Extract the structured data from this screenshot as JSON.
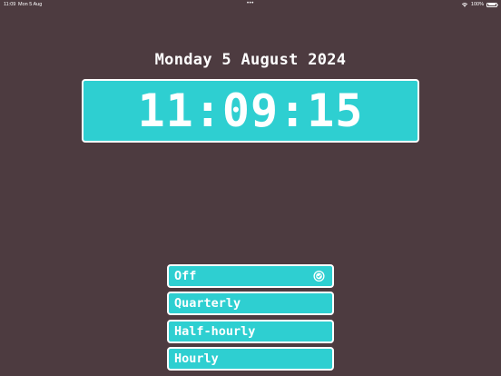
{
  "status_bar": {
    "time": "11:09",
    "date": "Mon 5 Aug",
    "dots": "•••",
    "battery_percent": "100%",
    "battery_level": 1.0
  },
  "date_title": "Monday 5 August 2024",
  "clock": {
    "time": "11:09:15"
  },
  "chime_options": [
    {
      "label": "Off",
      "selected": true
    },
    {
      "label": "Quarterly",
      "selected": false
    },
    {
      "label": "Half-hourly",
      "selected": false
    },
    {
      "label": "Hourly",
      "selected": false
    }
  ],
  "colors": {
    "background": "#4d3b40",
    "accent": "#2ecfd1",
    "text": "#ffffff"
  },
  "icons": {
    "selected_option": "check-circle-icon",
    "wifi": "wifi-icon",
    "battery": "battery-icon"
  }
}
